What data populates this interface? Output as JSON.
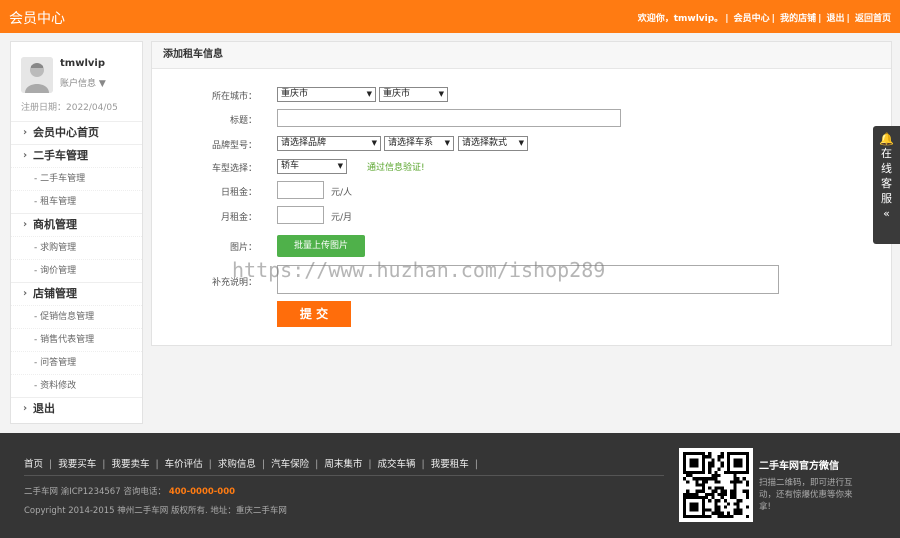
{
  "topbar": {
    "brand": "会员中心",
    "welcome": "欢迎你，tmwlvip。",
    "links": [
      "会员中心",
      "我的店铺",
      "退出",
      "返回首页"
    ]
  },
  "sidebar": {
    "username": "tmwlvip",
    "account_info": "账户信息",
    "reg_date": "注册日期：2022/04/05",
    "menu": [
      {
        "type": "section",
        "label": "会员中心首页"
      },
      {
        "type": "section",
        "label": "二手车管理"
      },
      {
        "type": "sub",
        "label": "二手车管理"
      },
      {
        "type": "sub",
        "label": "租车管理"
      },
      {
        "type": "section",
        "label": "商机管理"
      },
      {
        "type": "sub",
        "label": "求购管理"
      },
      {
        "type": "sub",
        "label": "询价管理"
      },
      {
        "type": "section",
        "label": "店铺管理"
      },
      {
        "type": "sub",
        "label": "促销信息管理"
      },
      {
        "type": "sub",
        "label": "销售代表管理"
      },
      {
        "type": "sub",
        "label": "问答管理"
      },
      {
        "type": "sub",
        "label": "资料修改"
      },
      {
        "type": "section",
        "label": "退出"
      }
    ]
  },
  "form": {
    "title": "添加租车信息",
    "city_label": "所在城市：",
    "city_province": "重庆市",
    "city_city": "重庆市",
    "title_label": "标题：",
    "brand_label": "品牌型号：",
    "brand_select": "请选择品牌",
    "series_select": "请选择车系",
    "style_select": "请选择款式",
    "type_label": "车型选择：",
    "type_select": "轿车",
    "verify_tip": "通过信息验证!",
    "day_label": "日租金：",
    "day_unit": "元/人",
    "month_label": "月租金：",
    "month_unit": "元/月",
    "image_label": "图片：",
    "upload_label": "批量上传图片",
    "extra_label": "补充说明：",
    "submit_label": "提 交"
  },
  "watermark": "https://www.huzhan.com/ishop289",
  "floater": {
    "chars": [
      "在",
      "线",
      "客",
      "服",
      "«"
    ]
  },
  "footer": {
    "nav": [
      "首页",
      "我要买车",
      "我要卖车",
      "车价评估",
      "求购信息",
      "汽车保险",
      "周末集市",
      "成交车辆",
      "我要租车"
    ],
    "icp": "二手车网  渝ICP1234567  咨询电话：",
    "phone": "400-0000-000",
    "copyright": "Copyright 2014-2015 神州二手车网 版权所有.   地址：重庆二手车网",
    "wx_title": "二手车网官方微信",
    "wx_desc": "扫描二维码，即可进行互动，还有惊爆优惠等你来拿!"
  },
  "colors": {
    "accent": "#ff7b12",
    "upload": "#4fb14a",
    "footer": "#353535"
  }
}
